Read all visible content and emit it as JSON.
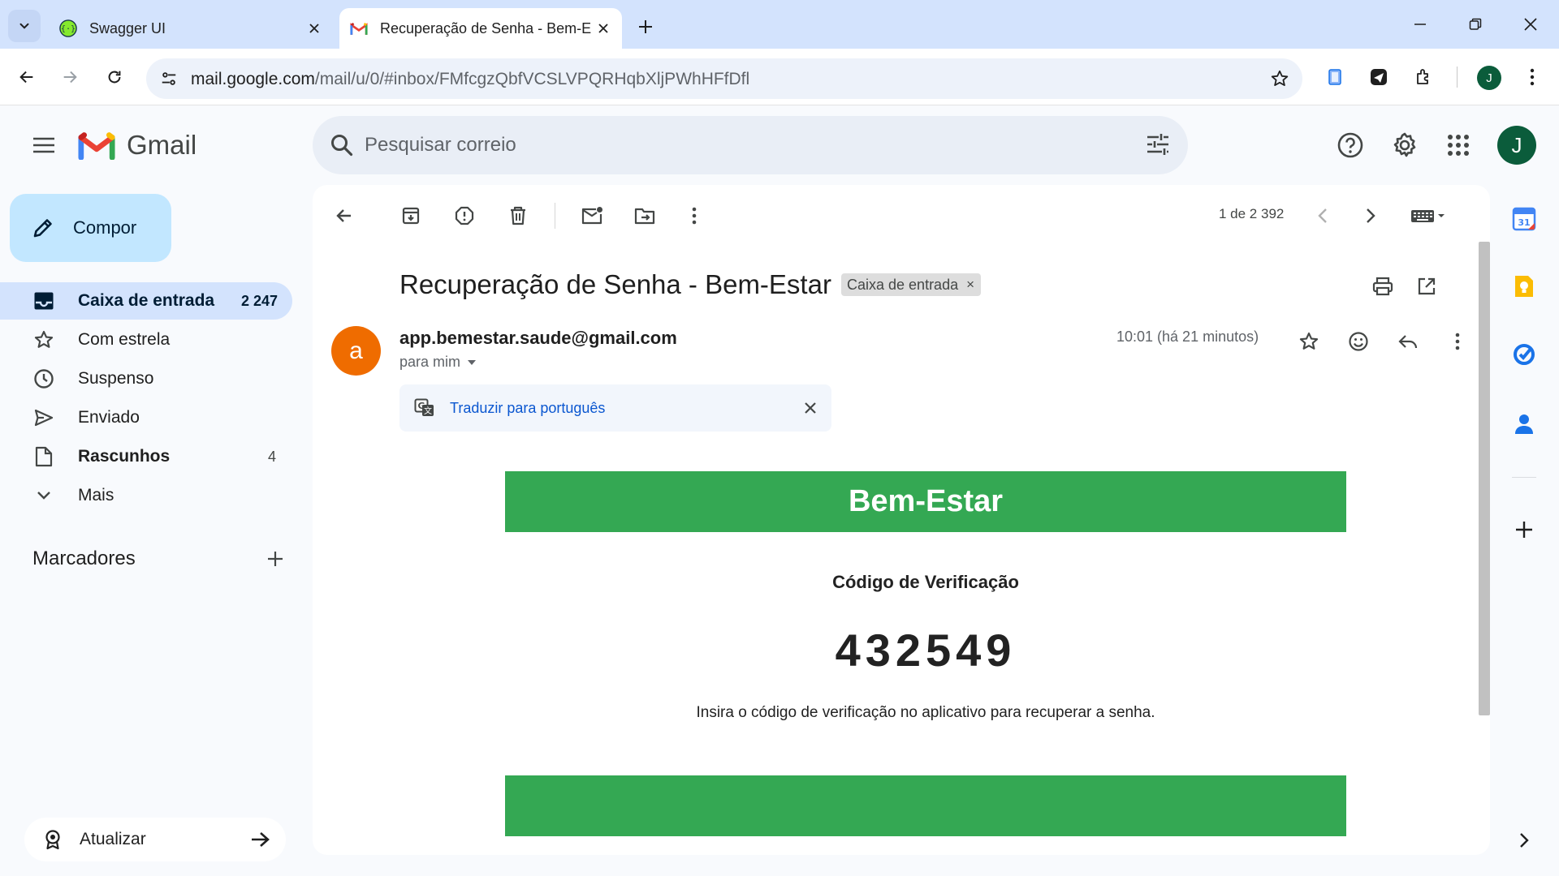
{
  "browser": {
    "tabs": [
      {
        "title": "Swagger UI",
        "favicon": "swagger-icon",
        "active": false
      },
      {
        "title": "Recuperação de Senha - Bem-E",
        "favicon": "gmail-icon",
        "active": true
      }
    ],
    "url_host": "mail.google.com",
    "url_path": "/mail/u/0/#inbox/FMfcgzQbfVCSLVPQRHqbXljPWhHFfDfl",
    "profile_initial": "J"
  },
  "gmail": {
    "logo_text": "Gmail",
    "search_placeholder": "Pesquisar correio",
    "account_initial": "J",
    "compose_label": "Compor",
    "nav": [
      {
        "label": "Caixa de entrada",
        "count": "2 247",
        "icon": "inbox-icon"
      },
      {
        "label": "Com estrela",
        "count": "",
        "icon": "star-icon"
      },
      {
        "label": "Suspenso",
        "count": "",
        "icon": "clock-icon"
      },
      {
        "label": "Enviado",
        "count": "",
        "icon": "send-icon"
      },
      {
        "label": "Rascunhos",
        "count": "4",
        "icon": "draft-icon"
      },
      {
        "label": "Mais",
        "count": "",
        "icon": "chevron-down-icon"
      }
    ],
    "labels_title": "Marcadores",
    "upgrade_label": "Atualizar"
  },
  "message": {
    "pager": "1 de 2 392",
    "subject": "Recuperação de Senha - Bem-Estar",
    "label_chip": "Caixa de entrada",
    "sender_initial": "a",
    "sender": "app.bemestar.saude@gmail.com",
    "to": "para mim",
    "time": "10:01 (há 21 minutos)",
    "translate_link": "Traduzir para português",
    "body": {
      "brand": "Bem-Estar",
      "heading": "Código de Verificação",
      "code": "432549",
      "note": "Insira o código de verificação no aplicativo para recuperar a senha."
    }
  },
  "colors": {
    "accent_green": "#34a853",
    "compose_bg": "#c2e7ff",
    "active_nav_bg": "#d3e3fd",
    "sender_avatar": "#ef6c00",
    "account_avatar": "#0b5c3b"
  }
}
